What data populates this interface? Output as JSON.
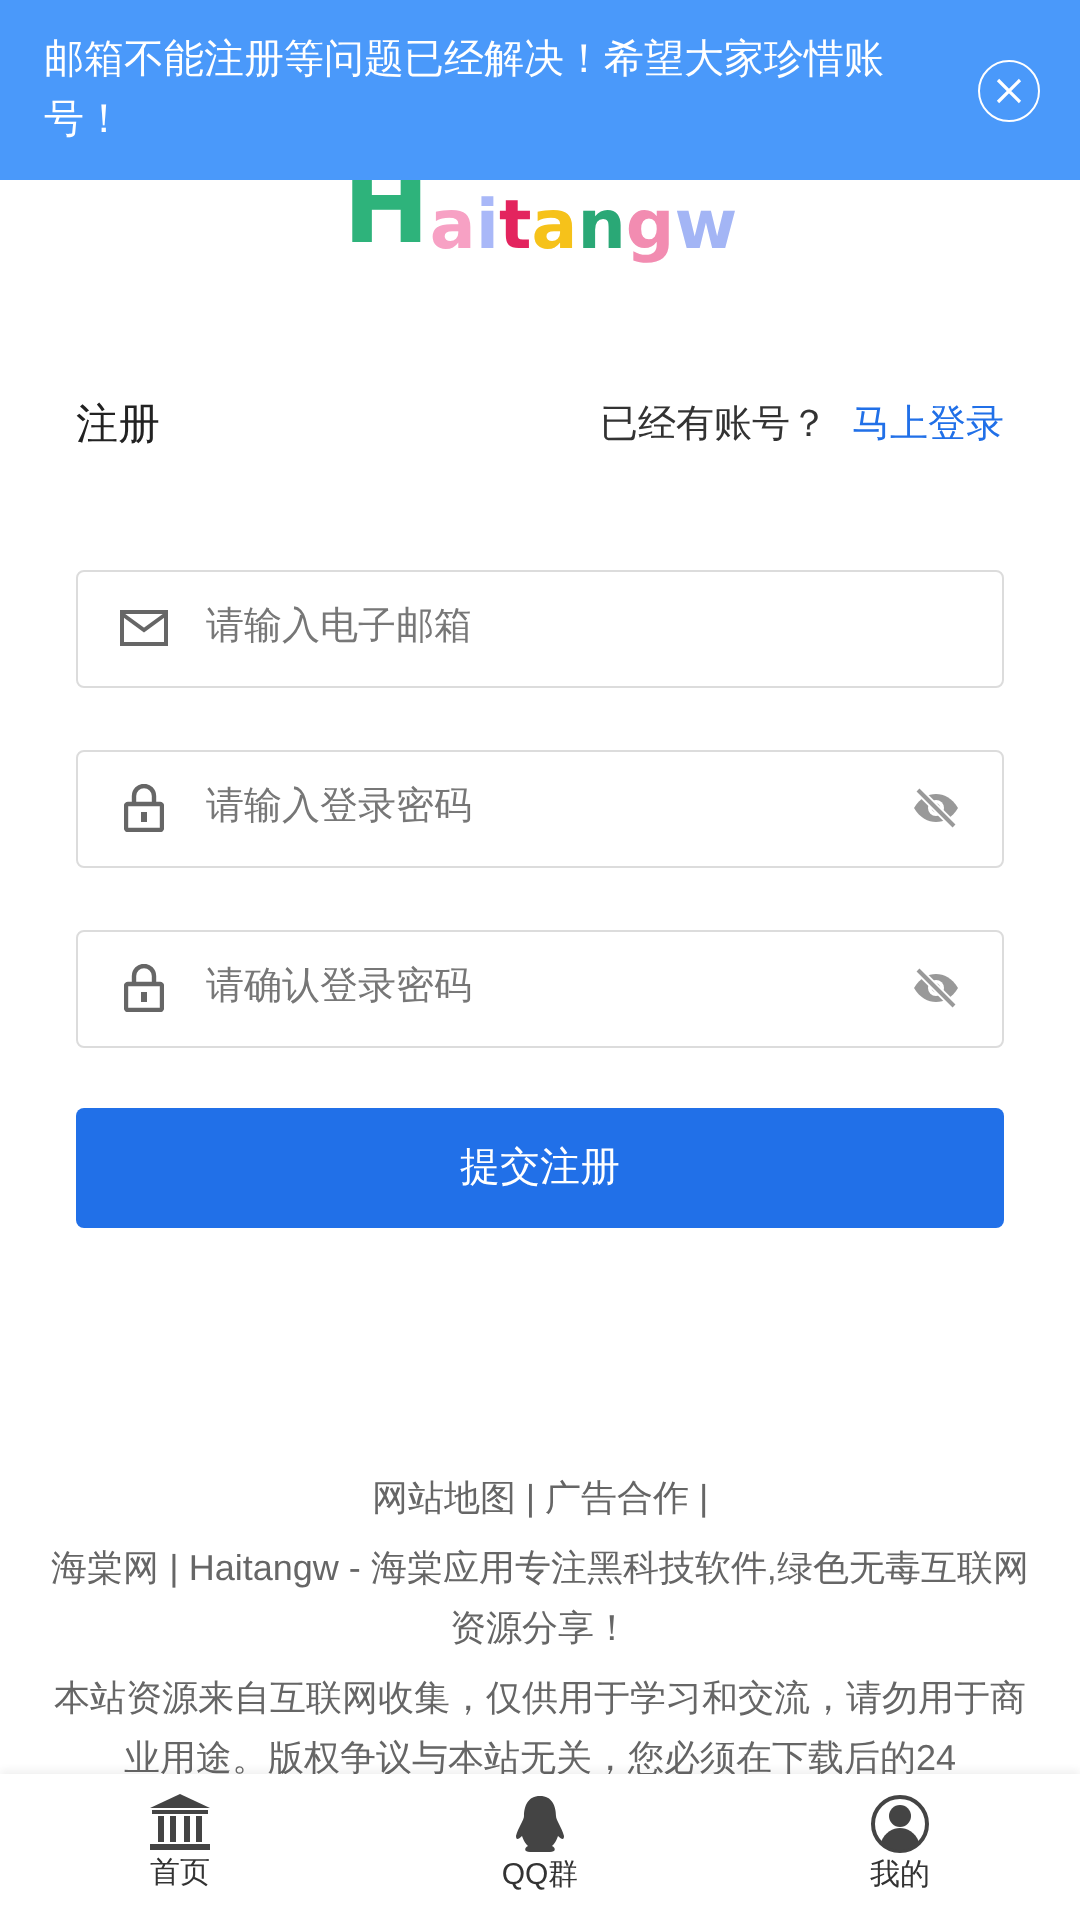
{
  "banner": {
    "text": "邮箱不能注册等问题已经解决！希望大家珍惜账号！"
  },
  "logo": [
    {
      "char": "H",
      "color": "#2eb37b"
    },
    {
      "char": "a",
      "color": "#f7a1c4"
    },
    {
      "char": "i",
      "color": "#a9b8f8"
    },
    {
      "char": "t",
      "color": "#e3245e"
    },
    {
      "char": "a",
      "color": "#f6c21a"
    },
    {
      "char": "n",
      "color": "#2aa876"
    },
    {
      "char": "g",
      "color": "#f28cb1"
    },
    {
      "char": "w",
      "color": "#a3b5f5"
    }
  ],
  "form": {
    "title": "注册",
    "login_prompt": "已经有账号？",
    "login_link": "马上登录",
    "fields": [
      {
        "kind": "email",
        "placeholder": "请输入电子邮箱"
      },
      {
        "kind": "password",
        "placeholder": "请输入登录密码"
      },
      {
        "kind": "password",
        "placeholder": "请确认登录密码"
      }
    ],
    "submit": "提交注册"
  },
  "footer": {
    "links": "网站地图 | 广告合作 |",
    "tagline": "海棠网 | Haitangw - 海棠应用专注黑科技软件,绿色无毒互联网资源分享！",
    "disclaimer": "本站资源来自互联网收集，仅供用于学习和交流，请勿用于商业用途。版权争议与本站无关，您必须在下载后的24"
  },
  "bottom_nav": [
    {
      "kind": "home",
      "label": "首页"
    },
    {
      "kind": "qq",
      "label": "QQ群"
    },
    {
      "kind": "user",
      "label": "我的"
    }
  ]
}
